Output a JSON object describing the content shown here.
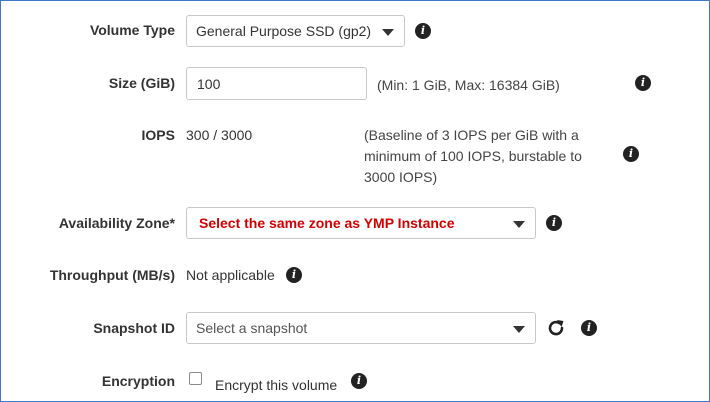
{
  "volume_type": {
    "label": "Volume Type",
    "selected": "General Purpose SSD (gp2)"
  },
  "size": {
    "label": "Size (GiB)",
    "value": "100",
    "hint": "(Min: 1 GiB, Max: 16384 GiB)"
  },
  "iops": {
    "label": "IOPS",
    "value": "300 / 3000",
    "hint_lines": [
      "(Baseline of 3 IOPS per GiB with a",
      "minimum of 100 IOPS, burstable to",
      "3000 IOPS)"
    ]
  },
  "availability_zone": {
    "label": "Availability Zone*",
    "selected": "Select the same zone as YMP Instance",
    "selected_color": "#d40000"
  },
  "throughput": {
    "label": "Throughput (MB/s)",
    "value": "Not applicable"
  },
  "snapshot": {
    "label": "Snapshot ID",
    "placeholder": "Select a snapshot"
  },
  "encryption": {
    "label": "Encryption",
    "checkbox_label": "Encrypt this volume",
    "checked": false
  },
  "icons": {
    "info": "info-icon",
    "caret": "caret-down-icon",
    "refresh": "refresh-icon"
  },
  "colors": {
    "frame_border": "#3d78c9",
    "warning_text": "#d40000"
  }
}
